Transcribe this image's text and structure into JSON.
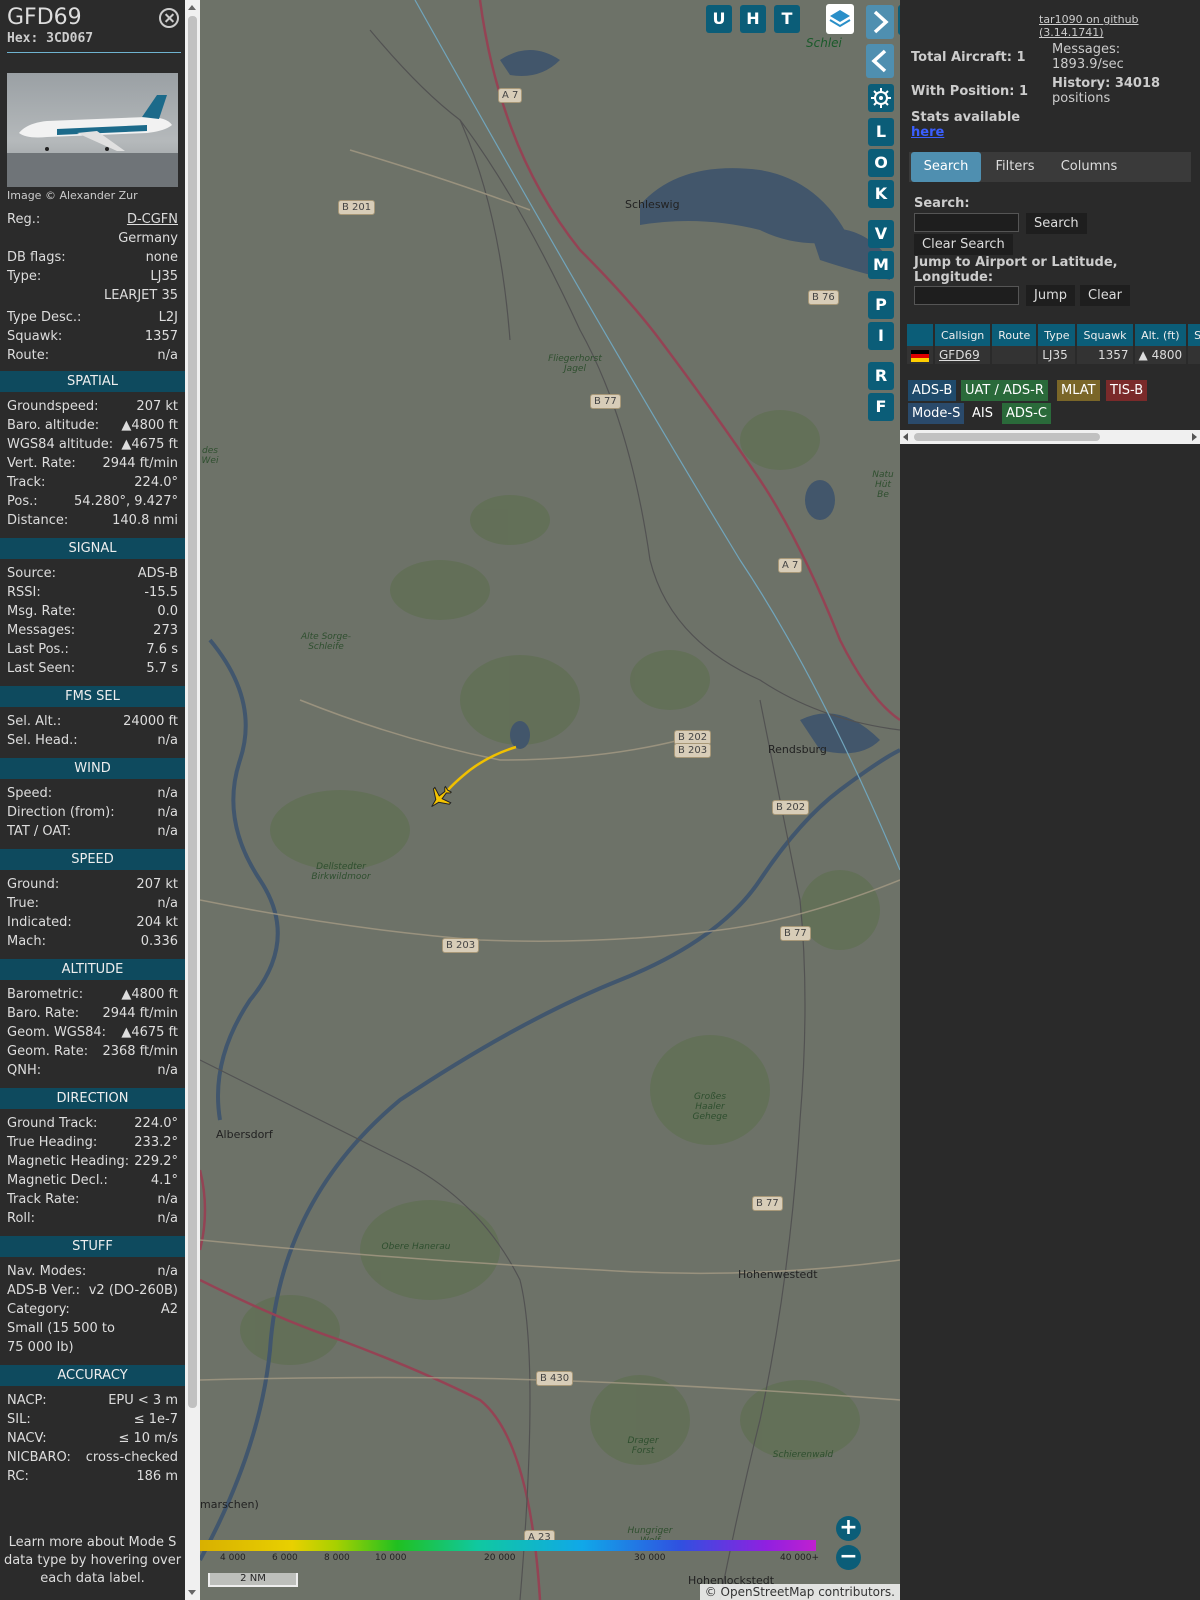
{
  "info": {
    "callsign": "GFD69",
    "hex": "Hex: 3CD067",
    "photo_credit": "Image © Alexander Zur",
    "basic": [
      {
        "k": "Reg.:",
        "v": "D-CGFN"
      },
      {
        "k": "",
        "v": "Germany"
      },
      {
        "k": "DB flags:",
        "v": "none"
      },
      {
        "k": "Type:",
        "v": "LJ35"
      },
      {
        "k": "",
        "v": "LEARJET 35"
      },
      {
        "k": "Type Desc.:",
        "v": "L2J"
      },
      {
        "k": "Squawk:",
        "v": "1357"
      },
      {
        "k": "Route:",
        "v": "n/a"
      }
    ],
    "sections": [
      {
        "title": "SPATIAL",
        "rows": [
          {
            "k": "Groundspeed:",
            "v": "207 kt"
          },
          {
            "k": "Baro. altitude:",
            "v": "▲4800 ft"
          },
          {
            "k": "WGS84 altitude:",
            "v": "▲4675 ft"
          },
          {
            "k": "Vert. Rate:",
            "v": "2944 ft/min"
          },
          {
            "k": "Track:",
            "v": "224.0°"
          },
          {
            "k": "Pos.:",
            "v": "54.280°, 9.427°"
          },
          {
            "k": "Distance:",
            "v": "140.8 nmi"
          }
        ]
      },
      {
        "title": "SIGNAL",
        "rows": [
          {
            "k": "Source:",
            "v": "ADS-B"
          },
          {
            "k": "RSSI:",
            "v": "-15.5"
          },
          {
            "k": "Msg. Rate:",
            "v": "0.0"
          },
          {
            "k": "Messages:",
            "v": "273"
          },
          {
            "k": "Last Pos.:",
            "v": "7.6 s"
          },
          {
            "k": "Last Seen:",
            "v": "5.7 s"
          }
        ]
      },
      {
        "title": "FMS SEL",
        "rows": [
          {
            "k": "Sel. Alt.:",
            "v": "24000 ft"
          },
          {
            "k": "Sel. Head.:",
            "v": "n/a"
          }
        ]
      },
      {
        "title": "WIND",
        "rows": [
          {
            "k": "Speed:",
            "v": "n/a"
          },
          {
            "k": "Direction (from):",
            "v": "n/a"
          },
          {
            "k": "TAT / OAT:",
            "v": "n/a"
          }
        ]
      },
      {
        "title": "SPEED",
        "rows": [
          {
            "k": "Ground:",
            "v": "207 kt"
          },
          {
            "k": "True:",
            "v": "n/a"
          },
          {
            "k": "Indicated:",
            "v": "204 kt"
          },
          {
            "k": "Mach:",
            "v": "0.336"
          }
        ]
      },
      {
        "title": "ALTITUDE",
        "rows": [
          {
            "k": "Barometric:",
            "v": "▲4800 ft"
          },
          {
            "k": "Baro. Rate:",
            "v": "2944 ft/min"
          },
          {
            "k": "Geom. WGS84:",
            "v": "▲4675 ft"
          },
          {
            "k": "Geom. Rate:",
            "v": "2368 ft/min"
          },
          {
            "k": "QNH:",
            "v": "n/a"
          }
        ]
      },
      {
        "title": "DIRECTION",
        "rows": [
          {
            "k": "Ground Track:",
            "v": "224.0°"
          },
          {
            "k": "True Heading:",
            "v": "233.2°"
          },
          {
            "k": "Magnetic Heading:",
            "v": "229.2°"
          },
          {
            "k": "Magnetic Decl.:",
            "v": "4.1°"
          },
          {
            "k": "Track Rate:",
            "v": "n/a"
          },
          {
            "k": "Roll:",
            "v": "n/a"
          }
        ]
      },
      {
        "title": "STUFF",
        "rows": [
          {
            "k": "Nav. Modes:",
            "v": "n/a"
          },
          {
            "k": "ADS-B Ver.:",
            "v": "v2 (DO-260B)"
          },
          {
            "k": "Category:",
            "v": "A2"
          },
          {
            "k": "Small (15 500 to",
            "v": ""
          },
          {
            "k": "75 000 lb)",
            "v": ""
          }
        ]
      },
      {
        "title": "ACCURACY",
        "rows": [
          {
            "k": "NACP:",
            "v": "EPU < 3 m"
          },
          {
            "k": "SIL:",
            "v": "≤ 1e-7"
          },
          {
            "k": "NACV:",
            "v": "≤ 10 m/s"
          },
          {
            "k": "NICBARO:",
            "v": "cross-checked"
          },
          {
            "k": "RC:",
            "v": "186 m"
          }
        ]
      }
    ],
    "learn_more": "Learn more about Mode S data type by hovering over each data label."
  },
  "map": {
    "top_buttons": [
      "U",
      "H",
      "T"
    ],
    "side_buttons": [
      "L",
      "O",
      "K",
      "V",
      "M",
      "P",
      "I",
      "R",
      "F"
    ],
    "schlei_label": "Schlei",
    "towns": [
      "Schleswig",
      "Rendsburg",
      "Albersdorf",
      "Hohenwestedt",
      "Hohenlockstedt",
      "marschen)"
    ],
    "roads": [
      "A 7",
      "B 201",
      "B 76",
      "B 77",
      "A 7",
      "B 202",
      "B 203",
      "B 202",
      "B 77",
      "B 203",
      "B 77",
      "B 430",
      "A 23"
    ],
    "forests": [
      "Fliegerhorst Jagel",
      "Alte Sorge-Schleife",
      "Dellstedter Birkwildmoor",
      "Großes Haaler Gehege",
      "Obere Hanerau",
      "Schierenwald",
      "Drager Forst",
      "Hungriger Wolf",
      "Natu Hüt Be",
      "des Wei"
    ],
    "colorbar_ticks": [
      "4 000",
      "6 000",
      "8 000",
      "10 000",
      "20 000",
      "30 000",
      "40 000+"
    ],
    "scale": "2 NM",
    "attribution": "© OpenStreetMap contributors."
  },
  "panel": {
    "github": "tar1090 on github (3.14.1741)",
    "total_aircraft": "Total Aircraft: 1",
    "with_position": "With Position: 1",
    "messages_label": "Messages:",
    "messages_value": "1893.9/sec",
    "history_label": "History: 34018",
    "history_value": "positions",
    "stats_text": "Stats available",
    "stats_link": "here",
    "tabs": [
      "Search",
      "Filters",
      "Columns"
    ],
    "search_label": "Search:",
    "search_btn": "Search",
    "clear_search_btn": "Clear Search",
    "jump_label": "Jump to Airport or Latitude, Longitude:",
    "jump_btn": "Jump",
    "clear_btn": "Clear",
    "columns": [
      "",
      "Callsign",
      "Route",
      "Type",
      "Squawk",
      "Alt. (ft)",
      "Spd"
    ],
    "row": {
      "callsign": "GFD69",
      "route": "",
      "type": "LJ35",
      "squawk": "1357",
      "alt": "▲ 4800"
    },
    "badges": [
      {
        "label": "ADS-B",
        "color": "#1f4a6b"
      },
      {
        "label": "UAT / ADS-R",
        "color": "#2a6a3a"
      },
      {
        "label": "MLAT",
        "color": "#7a6628"
      },
      {
        "label": "TIS-B",
        "color": "#7a2a2a"
      },
      {
        "label": "Mode-S",
        "color": "#2a4a6b"
      },
      {
        "label": "AIS",
        "color": "#2a2a2a"
      },
      {
        "label": "ADS-C",
        "color": "#2a6a3a"
      }
    ]
  }
}
